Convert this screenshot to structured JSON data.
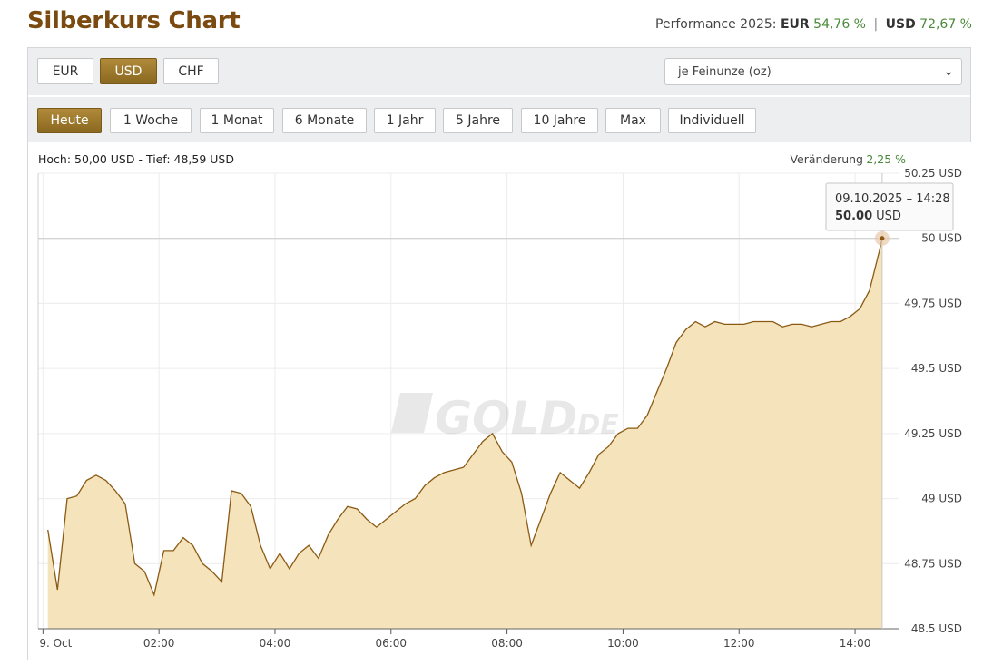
{
  "header": {
    "title": "Silberkurs Chart",
    "performance_label": "Performance 2025:",
    "eur_label": "EUR",
    "eur_value": "54,76 %",
    "separator": "|",
    "usd_label": "USD",
    "usd_value": "72,67 %"
  },
  "currency_buttons": [
    "EUR",
    "USD",
    "CHF"
  ],
  "unit_select": "je Feinunze (oz)",
  "range_buttons": [
    "Heute",
    "1 Woche",
    "1 Monat",
    "6 Monate",
    "1 Jahr",
    "5 Jahre",
    "10 Jahre",
    "Max",
    "Individuell"
  ],
  "stats": {
    "high_low": "Hoch: 50,00 USD - Tief: 48,59 USD",
    "change_label": "Veränderung",
    "change_value": "2,25 %"
  },
  "tooltip": {
    "datetime": "09.10.2025 – 14:28",
    "value": "50.00",
    "unit": "USD"
  },
  "watermark": "GOLD.DE",
  "colors": {
    "brand": "#7a4a10",
    "positive": "#4a8a3a",
    "active_button": "#9a7628",
    "line": "#8a5a14",
    "area": "#f5e3bc"
  },
  "chart_data": {
    "type": "area",
    "title": "",
    "xlabel": "",
    "ylabel": "",
    "ylim": [
      48.5,
      50.25
    ],
    "x_ticks": [
      "9. Oct",
      "02:00",
      "04:00",
      "06:00",
      "08:00",
      "10:00",
      "12:00",
      "14:00"
    ],
    "y_ticks": [
      "50.25 USD",
      "50 USD",
      "49.75 USD",
      "49.5 USD",
      "49.25 USD",
      "49 USD",
      "48.75 USD",
      "48.5 USD"
    ],
    "series": [
      {
        "x": [
          "00:05",
          "00:15",
          "00:25",
          "00:35",
          "00:45",
          "00:55",
          "01:05",
          "01:15",
          "01:25",
          "01:35",
          "01:45",
          "01:55",
          "02:05",
          "02:15",
          "02:25",
          "02:35",
          "02:45",
          "02:55",
          "03:05",
          "03:15",
          "03:25",
          "03:35",
          "03:45",
          "03:55",
          "04:05",
          "04:15",
          "04:25",
          "04:35",
          "04:45",
          "04:55",
          "05:05",
          "05:15",
          "05:25",
          "05:35",
          "05:45",
          "05:55",
          "06:05",
          "06:15",
          "06:25",
          "06:35",
          "06:45",
          "06:55",
          "07:05",
          "07:15",
          "07:25",
          "07:35",
          "07:45",
          "07:55",
          "08:05",
          "08:15",
          "08:25",
          "08:35",
          "08:45",
          "08:55",
          "09:05",
          "09:15",
          "09:25",
          "09:35",
          "09:45",
          "09:55",
          "10:05",
          "10:15",
          "10:25",
          "10:35",
          "10:45",
          "10:55",
          "11:05",
          "11:15",
          "11:25",
          "11:35",
          "11:45",
          "11:55",
          "12:05",
          "12:15",
          "12:25",
          "12:35",
          "12:45",
          "12:55",
          "13:05",
          "13:15",
          "13:25",
          "13:35",
          "13:45",
          "13:55",
          "14:05",
          "14:15",
          "14:25",
          "14:28"
        ],
        "values": [
          48.88,
          48.65,
          49.0,
          49.01,
          49.07,
          49.09,
          49.07,
          49.03,
          48.98,
          48.75,
          48.72,
          48.63,
          48.8,
          48.8,
          48.85,
          48.82,
          48.75,
          48.72,
          48.68,
          49.03,
          49.02,
          48.97,
          48.82,
          48.73,
          48.79,
          48.73,
          48.79,
          48.82,
          48.77,
          48.86,
          48.92,
          48.97,
          48.96,
          48.92,
          48.89,
          48.92,
          48.95,
          48.98,
          49.0,
          49.05,
          49.08,
          49.1,
          49.11,
          49.12,
          49.17,
          49.22,
          49.25,
          49.18,
          49.14,
          49.02,
          48.82,
          48.92,
          49.02,
          49.1,
          49.07,
          49.04,
          49.1,
          49.17,
          49.2,
          49.25,
          49.27,
          49.27,
          49.32,
          49.41,
          49.5,
          49.6,
          49.65,
          49.68,
          49.66,
          49.68,
          49.67,
          49.67,
          49.67,
          49.68,
          49.68,
          49.68,
          49.66,
          49.67,
          49.67,
          49.66,
          49.67,
          49.68,
          49.68,
          49.7,
          49.73,
          49.8,
          49.95,
          50.0
        ]
      }
    ]
  }
}
